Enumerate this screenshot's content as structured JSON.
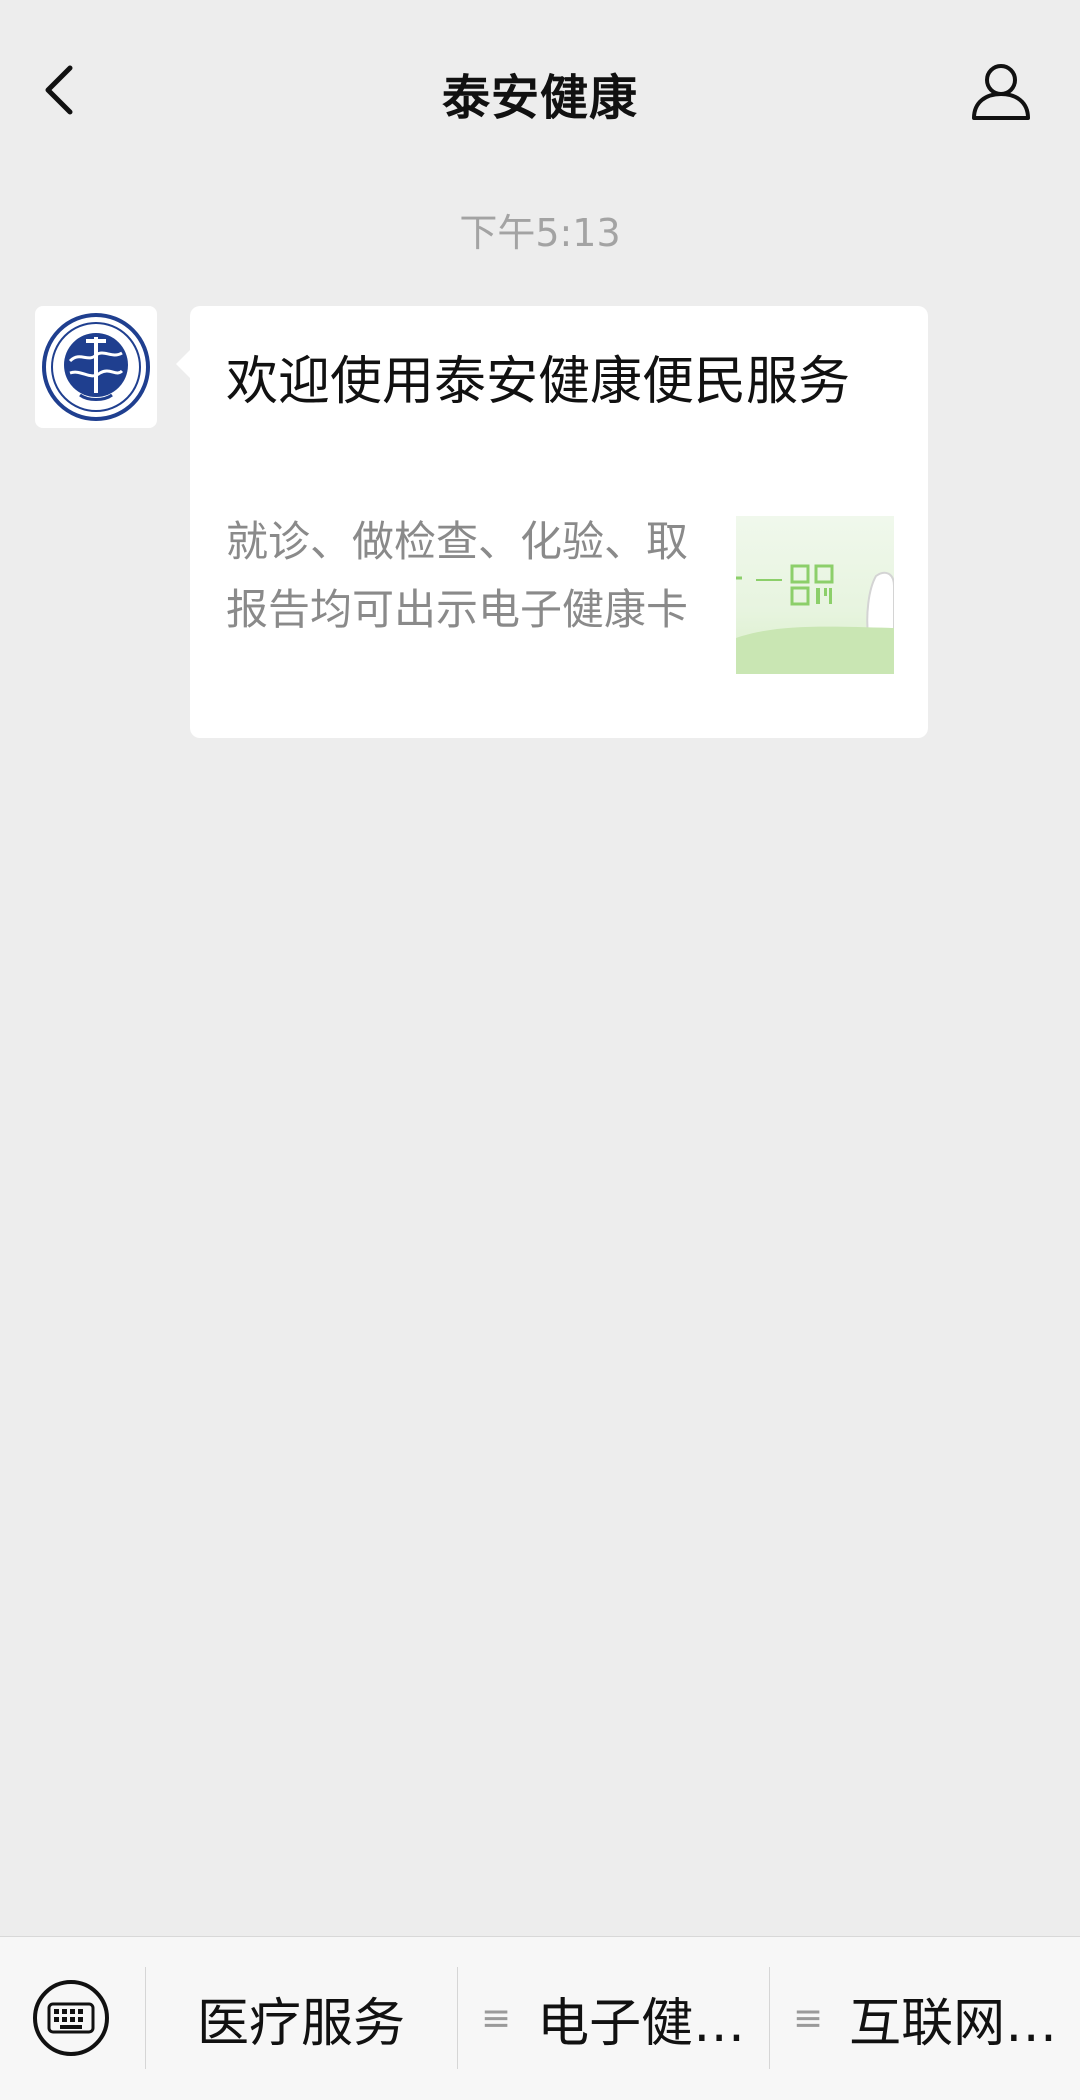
{
  "nav": {
    "title": "泰安健康",
    "back_icon": "chevron-left-icon",
    "profile_icon": "person-icon"
  },
  "chat": {
    "timestamp": "下午5:13",
    "message": {
      "title": "欢迎使用泰安健康便民服务",
      "description": "就诊、做检查、化验、取报告均可出示电子健康卡"
    }
  },
  "bottom_menu": {
    "keyboard_icon": "keyboard-icon",
    "items": [
      {
        "label": "医疗服务"
      },
      {
        "label": "电子健…",
        "icon": "≡"
      },
      {
        "label": "互联网…",
        "icon": "≡"
      }
    ]
  },
  "colors": {
    "background": "#ededed",
    "bubble": "#ffffff",
    "timestamp": "#a3a3a3",
    "accent_green": "#8ccf6a",
    "logo_blue": "#1f3f8f"
  }
}
